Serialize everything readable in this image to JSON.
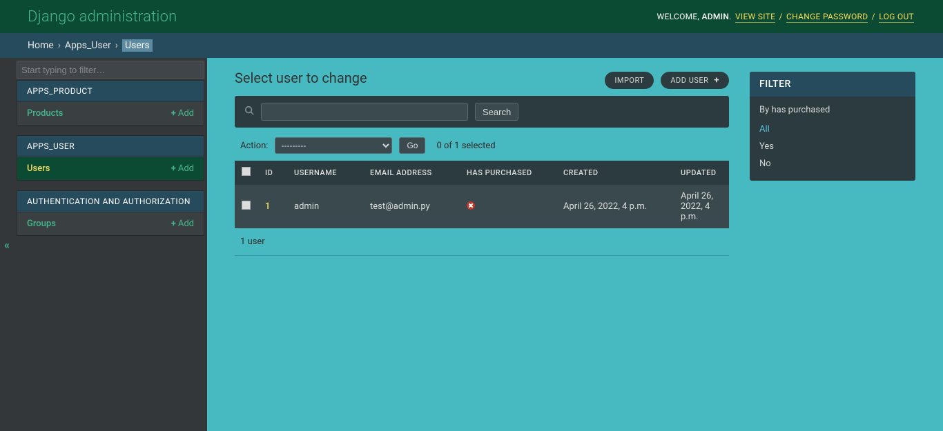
{
  "header": {
    "branding": "Django administration",
    "welcome_prefix": "WELCOME,",
    "user_name": "ADMIN",
    "dot": ".",
    "view_site": "VIEW SITE",
    "change_password": "CHANGE PASSWORD",
    "logout": "LOG OUT",
    "sep": "/"
  },
  "breadcrumbs": {
    "home": "Home",
    "sep": "›",
    "app": "Apps_User",
    "current": "Users"
  },
  "sidebar": {
    "filter_placeholder": "Start typing to filter…",
    "modules": [
      {
        "caption": "APPS_PRODUCT",
        "models": [
          {
            "name": "Products",
            "add_label": "Add",
            "active": false
          }
        ]
      },
      {
        "caption": "APPS_USER",
        "models": [
          {
            "name": "Users",
            "add_label": "Add",
            "active": true
          }
        ]
      },
      {
        "caption": "AUTHENTICATION AND AUTHORIZATION",
        "models": [
          {
            "name": "Groups",
            "add_label": "Add",
            "active": false
          }
        ]
      }
    ],
    "collapse_glyph": "«"
  },
  "page": {
    "title": "Select user to change",
    "object_tools": {
      "import": "IMPORT",
      "add_user": "ADD USER"
    },
    "search": {
      "button": "Search"
    },
    "actions": {
      "label": "Action:",
      "placeholder": "---------",
      "go": "Go",
      "counter": "0 of 1 selected"
    },
    "table": {
      "columns": [
        "ID",
        "USERNAME",
        "EMAIL ADDRESS",
        "HAS PURCHASED",
        "CREATED",
        "UPDATED"
      ],
      "rows": [
        {
          "id": "1",
          "username": "admin",
          "email": "test@admin.py",
          "has_purchased": false,
          "created": "April 26, 2022, 4 p.m.",
          "updated": "April 26, 2022, 4 p.m."
        }
      ]
    },
    "paginator": "1 user"
  },
  "filter": {
    "title": "FILTER",
    "section_label": "By has purchased",
    "options": [
      {
        "label": "All",
        "selected": true
      },
      {
        "label": "Yes",
        "selected": false
      },
      {
        "label": "No",
        "selected": false
      }
    ]
  }
}
